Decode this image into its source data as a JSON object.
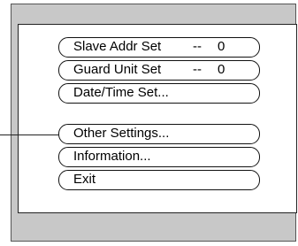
{
  "menu": {
    "items": [
      {
        "label": "Slave Addr Set",
        "dash": "--",
        "value": "0"
      },
      {
        "label": "Guard Unit Set",
        "dash": "--",
        "value": "0"
      },
      {
        "label": "Date/Time Set..."
      },
      {
        "label": "Other Settings..."
      },
      {
        "label": "Information..."
      },
      {
        "label": "Exit"
      }
    ],
    "highlighted_index": 3
  },
  "colors": {
    "screen_bg": "#c8c8c8",
    "panel_bg": "#ffffff",
    "border": "#111111"
  }
}
